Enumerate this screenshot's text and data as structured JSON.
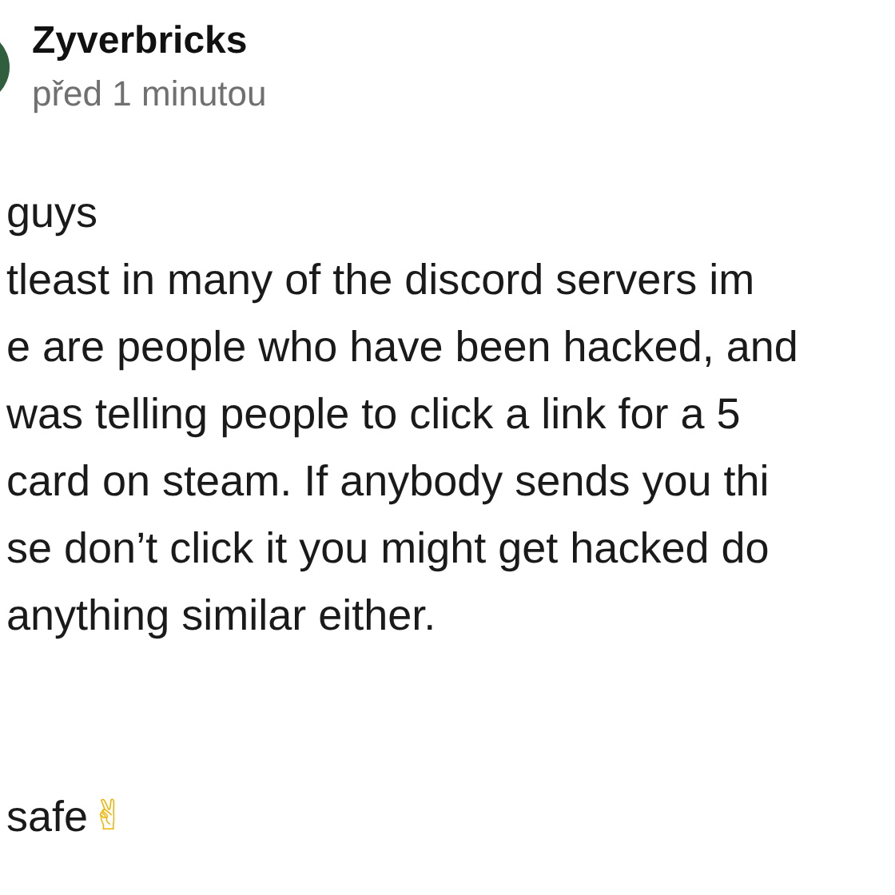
{
  "author": {
    "name": "Zyverbricks",
    "time": "před 1 minutou"
  },
  "body": {
    "lines": [
      "guys",
      "tleast in many of the discord servers im",
      "e are people who have been hacked, and",
      "was telling people to click a link for a 5",
      "card on steam. If anybody sends you thi",
      "se don’t click it you might get hacked do",
      "anything similar either."
    ],
    "closing": {
      "text": "safe",
      "emoji": "✌"
    }
  }
}
